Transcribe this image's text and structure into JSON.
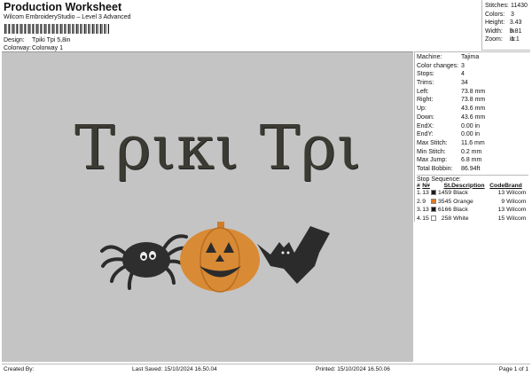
{
  "header": {
    "title": "Production Worksheet",
    "subtitle": "Wilcom EmbroideryStudio – Level 3 Advanced",
    "design_label": "Design:",
    "design_value": "Tpiki Tpi 5,8in",
    "colorway_label": "Colorway:",
    "colorway_value": "Colorway 1"
  },
  "stats": [
    {
      "k": "Stitches:",
      "v": "11430"
    },
    {
      "k": "Colors:",
      "v": "3"
    },
    {
      "k": "Height:",
      "v": "3.43 in"
    },
    {
      "k": "Width:",
      "v": "5.81 in"
    },
    {
      "k": "Zoom:",
      "v": "1:1"
    }
  ],
  "info": [
    {
      "k": "Machine:",
      "v": "Tajima"
    },
    {
      "k": "Color changes:",
      "v": "3"
    },
    {
      "k": "Stops:",
      "v": "4"
    },
    {
      "k": "Trims:",
      "v": "34"
    },
    {
      "k": "Left:",
      "v": "73.8 mm"
    },
    {
      "k": "Right:",
      "v": "73.8 mm"
    },
    {
      "k": "Up:",
      "v": "43.6 mm"
    },
    {
      "k": "Down:",
      "v": "43.6 mm"
    },
    {
      "k": "EndX:",
      "v": "0.00 in"
    },
    {
      "k": "EndY:",
      "v": "0.00 in"
    },
    {
      "k": "Max Stitch:",
      "v": "11.6 mm"
    },
    {
      "k": "Min Stitch:",
      "v": "0.2 mm"
    },
    {
      "k": "Max Jump:",
      "v": "6.8 mm"
    },
    {
      "k": "Total Bobbin:",
      "v": "86.94ft"
    }
  ],
  "stop_sequence": {
    "title": "Stop Sequence:",
    "headers": [
      "#",
      "N#",
      "St.",
      "Description",
      "Code",
      "Brand"
    ],
    "rows": [
      {
        "n": "1.",
        "nn": "13",
        "color": "#1a1a1a",
        "st": "1459",
        "desc": "Black",
        "code": "13",
        "brand": "Wilcom"
      },
      {
        "n": "2.",
        "nn": "9",
        "color": "#e07a1f",
        "st": "3545",
        "desc": "Orange",
        "code": "9",
        "brand": "Wilcom"
      },
      {
        "n": "3.",
        "nn": "13",
        "color": "#1a1a1a",
        "st": "6166",
        "desc": "Black",
        "code": "13",
        "brand": "Wilcom"
      },
      {
        "n": "4.",
        "nn": "15",
        "color": "#ffffff",
        "st": "258",
        "desc": "White",
        "code": "15",
        "brand": "Wilcom"
      }
    ]
  },
  "design": {
    "lettering": "Τρικι Τρι"
  },
  "footer": {
    "created": "Created By:",
    "saved": "Last Saved: 15/10/2024 16.50.04",
    "printed": "Printed: 15/10/2024 16.50.06",
    "page": "Page 1 of 1"
  }
}
